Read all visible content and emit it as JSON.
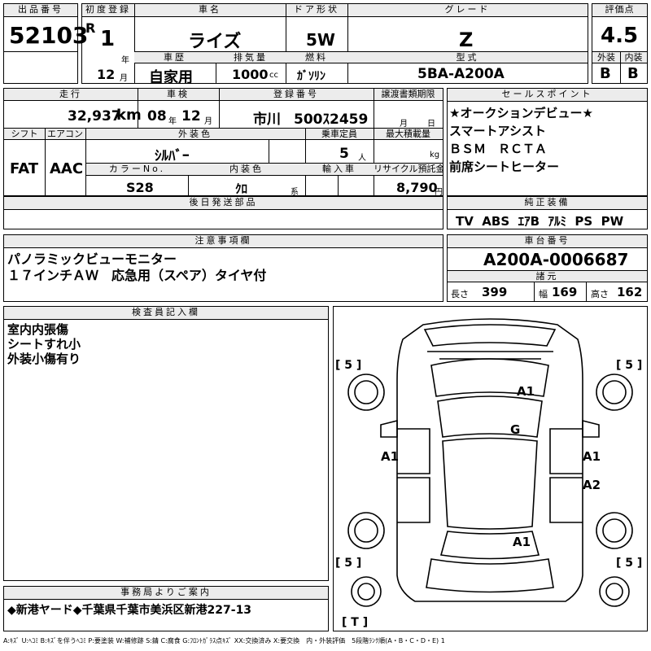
{
  "lot": {
    "label": "出品番号",
    "number": "52103"
  },
  "first_reg": {
    "label": "初度登録",
    "era": "R",
    "year": "1",
    "year_unit": "年",
    "month": "12",
    "month_unit": "月"
  },
  "car_name": {
    "label": "車名",
    "value": "ライズ"
  },
  "door": {
    "label": "ドア形状",
    "value": "5W"
  },
  "grade": {
    "label": "グレード",
    "value": "Z"
  },
  "score": {
    "label": "評価点",
    "value": "4.5",
    "ext_label": "外装",
    "int_label": "内装",
    "ext": "B",
    "int": "B"
  },
  "history": {
    "label": "車歴",
    "value": "自家用"
  },
  "displacement": {
    "label": "排気量",
    "value": "1000",
    "unit": "cc"
  },
  "fuel": {
    "label": "燃料",
    "value": "ｶﾞｿﾘﾝ"
  },
  "model": {
    "label": "型式",
    "value": "5BA-A200A"
  },
  "mileage": {
    "label": "走行",
    "value": "32,937",
    "unit": "km"
  },
  "inspection": {
    "label": "車検",
    "year": "08",
    "year_unit": "年",
    "month": "12",
    "month_unit": "月"
  },
  "plate": {
    "label": "登録番号",
    "area": "市川",
    "number": "500ｽ2459"
  },
  "transfer": {
    "label": "譲渡書類期限",
    "month_unit": "月",
    "day_unit": "日"
  },
  "shift": {
    "label": "シフト",
    "value": "FAT"
  },
  "aircon": {
    "label": "エアコン",
    "value": "AAC"
  },
  "ext_color": {
    "label": "外装色",
    "value": "ｼﾙﾊﾞｰ"
  },
  "capacity": {
    "label": "乗車定員",
    "value": "5",
    "unit": "人"
  },
  "max_load": {
    "label": "最大積載量",
    "unit": "kg"
  },
  "color_no": {
    "label": "カラーNo.",
    "value": "S28"
  },
  "int_color": {
    "label": "内装色",
    "value": "ｸﾛ",
    "unit": "系"
  },
  "import": {
    "label": "輸入車"
  },
  "recycle": {
    "label": "リサイクル預託金",
    "value": "8,790",
    "unit": "円"
  },
  "sales_points": {
    "label": "セールスポイント",
    "lines": [
      "★オークションデビュー★",
      "スマートアシスト",
      "ＢＳＭ　ＲＣＴＡ",
      "前席シートヒーター"
    ]
  },
  "later_parts": {
    "label": "後日発送部品"
  },
  "genuine": {
    "label": "純正装備",
    "value": "TV  ABS  ｴｱB  ｱﾙﾐ  PS  PW"
  },
  "notes": {
    "label": "注意事項欄",
    "lines": [
      "パノラミックビューモニター",
      "１７インチＡＷ　応急用（スペア）タイヤ付"
    ]
  },
  "chassis": {
    "label": "車台番号",
    "value": "A200A-0006687"
  },
  "specs": {
    "label": "諸元",
    "length_label": "長さ",
    "length": "399",
    "width_label": "幅",
    "width": "169",
    "height_label": "高さ",
    "height": "162"
  },
  "inspector": {
    "label": "検査員記入欄",
    "lines": [
      "室内内張傷",
      "シートすれ小",
      "外装小傷有り"
    ]
  },
  "diagram": {
    "marks": [
      "A1",
      "G",
      "A1",
      "A1",
      "A2",
      "A1"
    ],
    "tires": [
      "[ 5 ]",
      "[ 5 ]",
      "[ 5 ]",
      "[ 5 ]"
    ],
    "trunk": "[ T ]"
  },
  "office": {
    "label": "事務局よりご案内",
    "value": "◆新港ヤード◆千葉県千葉市美浜区新港227-13"
  },
  "legend": "A:ｷｽﾞ U:ﾍｺﾐ B:ｷｽﾞを伴うﾍｺﾐ P:要塗装 W:補修跡 S:錆 C:腐食 G:ﾌﾛﾝﾄｶﾞﾗｽ点ｷｽﾞ XX:交換済み X:要交換　内・外装評価　5段階ﾗﾝｸ順(A・B・C・D・E) 1"
}
